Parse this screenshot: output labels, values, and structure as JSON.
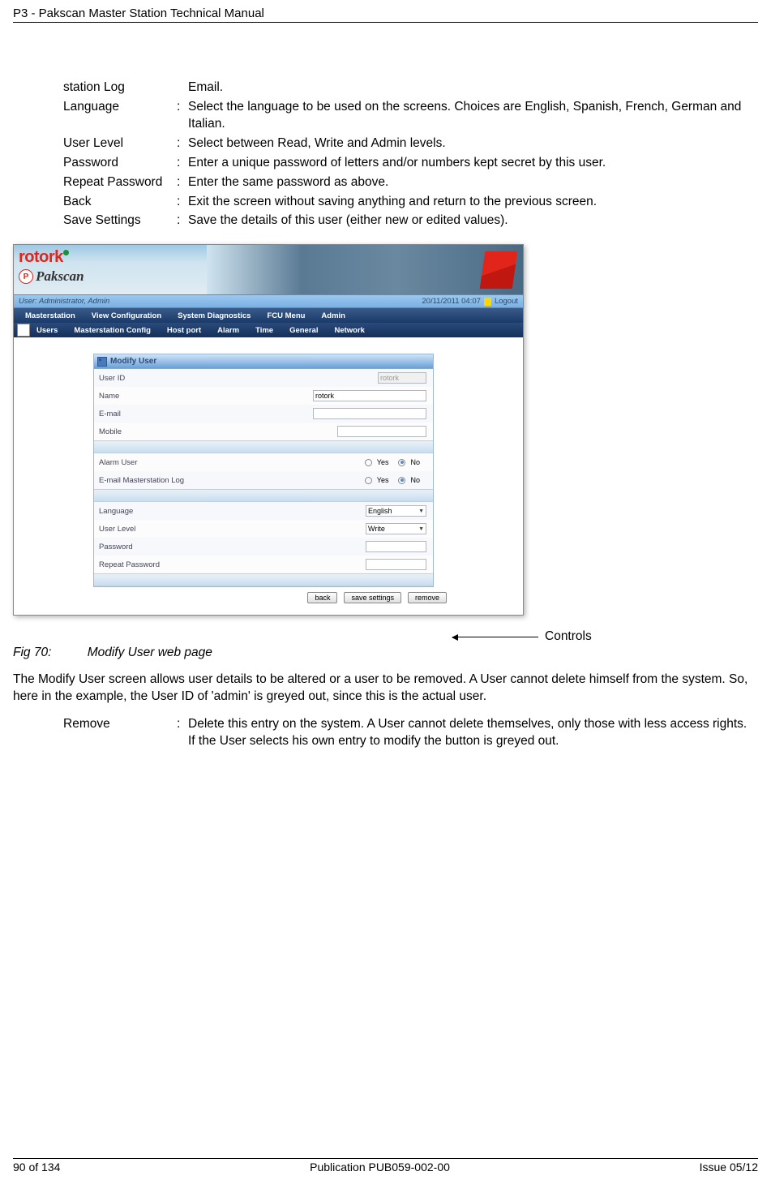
{
  "header": "P3 - Pakscan Master Station Technical Manual",
  "defs": {
    "stationLog": {
      "term": "station Log",
      "colon": "",
      "desc": "Email."
    },
    "language": {
      "term": "Language",
      "colon": ":",
      "desc": "Select the language to be used on the screens. Choices are English, Spanish, French, German and Italian."
    },
    "userLevel": {
      "term": "User Level",
      "colon": ":",
      "desc": "Select between Read, Write and Admin levels."
    },
    "password": {
      "term": "Password",
      "colon": ":",
      "desc": "Enter a unique password of letters and/or numbers kept secret by this user."
    },
    "repeatPassword": {
      "term": "Repeat Password",
      "colon": ":",
      "desc": "Enter the same password as above."
    },
    "back": {
      "term": "Back",
      "colon": ":",
      "desc": "Exit the screen without saving anything and return to the previous screen."
    },
    "saveSettings": {
      "term": "Save Settings",
      "colon": ":",
      "desc": "Save the details of this user (either new or edited values)."
    },
    "remove": {
      "term": "Remove",
      "colon": ":",
      "desc": "Delete this entry on the system. A User cannot delete themselves, only those with less access rights. If the User selects his own entry to modify the button is greyed out."
    }
  },
  "screenshot": {
    "logoTop": "rotork",
    "logoBot": "Pakscan",
    "logoP": "P",
    "status": {
      "user": "User: Administrator, Admin",
      "time": "20/11/2011 04:07",
      "logout": "Logout"
    },
    "menu": [
      "Masterstation",
      "View Configuration",
      "System Diagnostics",
      "FCU Menu",
      "Admin"
    ],
    "submenu": [
      "Users",
      "Masterstation Config",
      "Host port",
      "Alarm",
      "Time",
      "General",
      "Network"
    ],
    "panelTitle": "Modify User",
    "rows": {
      "userId": {
        "label": "User ID",
        "value": "rotork"
      },
      "name": {
        "label": "Name",
        "value": "rotork"
      },
      "email": {
        "label": "E-mail",
        "value": ""
      },
      "mobile": {
        "label": "Mobile",
        "value": ""
      },
      "alarmUser": {
        "label": "Alarm User",
        "yes": "Yes",
        "no": "No"
      },
      "emailLog": {
        "label": "E-mail Masterstation Log",
        "yes": "Yes",
        "no": "No"
      },
      "language": {
        "label": "Language",
        "value": "English"
      },
      "userLevel": {
        "label": "User Level",
        "value": "Write"
      },
      "password": {
        "label": "Password"
      },
      "repeatPassword": {
        "label": "Repeat Password"
      }
    },
    "buttons": {
      "back": "back",
      "save": "save settings",
      "remove": "remove"
    }
  },
  "callout": "Controls",
  "figure": {
    "num": "Fig 70:",
    "caption": "Modify User web page"
  },
  "paragraph": "The Modify User screen allows user details to be altered or a user to be removed. A User cannot delete himself from the system. So, here in the example, the User ID of 'admin' is greyed out, since this is the actual user.",
  "footer": {
    "left": "90 of 134",
    "center": "Publication PUB059-002-00",
    "right": "Issue 05/12"
  }
}
